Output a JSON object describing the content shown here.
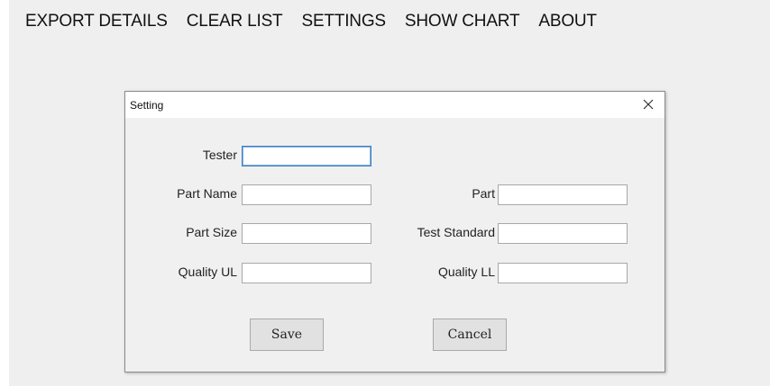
{
  "menu": {
    "items": [
      {
        "label": "EXPORT DETAILS"
      },
      {
        "label": "CLEAR LIST"
      },
      {
        "label": "SETTINGS"
      },
      {
        "label": "SHOW CHART"
      },
      {
        "label": "ABOUT"
      }
    ]
  },
  "dialog": {
    "title": "Setting",
    "close_icon": "close-icon",
    "fields": {
      "tester": {
        "label": "Tester",
        "value": ""
      },
      "part_name": {
        "label": "Part Name",
        "value": ""
      },
      "part": {
        "label": "Part",
        "value": ""
      },
      "part_size": {
        "label": "Part Size",
        "value": ""
      },
      "test_standard": {
        "label": "Test Standard",
        "value": ""
      },
      "quality_ul": {
        "label": "Quality UL",
        "value": ""
      },
      "quality_ll": {
        "label": "Quality LL",
        "value": ""
      }
    },
    "buttons": {
      "save": "Save",
      "cancel": "Cancel"
    }
  },
  "colors": {
    "window_background": "#efefef",
    "titlebar_background": "#ffffff",
    "focus_border": "#3d7fc1"
  }
}
